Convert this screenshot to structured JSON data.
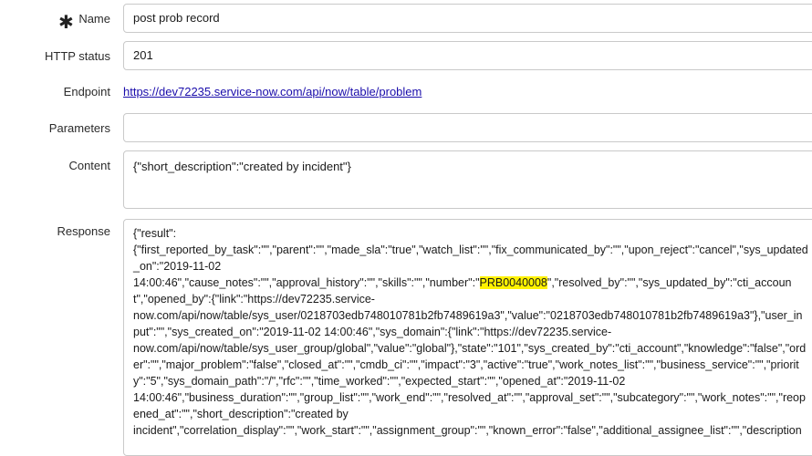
{
  "form": {
    "name": {
      "required_icon": "asterisk-icon",
      "required_glyph": "✱",
      "label": "Name",
      "value": "post prob record"
    },
    "http_status": {
      "label": "HTTP status",
      "value": "201"
    },
    "endpoint": {
      "label": "Endpoint",
      "value": "https://dev72235.service-now.com/api/now/table/problem"
    },
    "parameters": {
      "label": "Parameters",
      "value": ""
    },
    "content": {
      "label": "Content",
      "value": "{\"short_description\":\"created by incident\"}"
    },
    "response": {
      "label": "Response",
      "text_before": "{\"result\":\n{\"first_reported_by_task\":\"\",\"parent\":\"\",\"made_sla\":\"true\",\"watch_list\":\"\",\"fix_communicated_by\":\"\",\"upon_reject\":\"cancel\",\"sys_updated_on\":\"2019-11-02\n14:00:46\",\"cause_notes\":\"\",\"approval_history\":\"\",\"skills\":\"\",\"number\":\"",
      "highlight": "PRB0040008",
      "text_after": "\",\"resolved_by\":\"\",\"sys_updated_by\":\"cti_account\",\"opened_by\":{\"link\":\"https://dev72235.service-\nnow.com/api/now/table/sys_user/0218703edb748010781b2fb7489619a3\",\"value\":\"0218703edb748010781b2fb7489619a3\"},\"user_input\":\"\",\"sys_created_on\":\"2019-11-02 14:00:46\",\"sys_domain\":{\"link\":\"https://dev72235.service-\nnow.com/api/now/table/sys_user_group/global\",\"value\":\"global\"},\"state\":\"101\",\"sys_created_by\":\"cti_account\",\"knowledge\":\"false\",\"order\":\"\",\"major_problem\":\"false\",\"closed_at\":\"\",\"cmdb_ci\":\"\",\"impact\":\"3\",\"active\":\"true\",\"work_notes_list\":\"\",\"business_service\":\"\",\"priority\":\"5\",\"sys_domain_path\":\"/\",\"rfc\":\"\",\"time_worked\":\"\",\"expected_start\":\"\",\"opened_at\":\"2019-11-02\n14:00:46\",\"business_duration\":\"\",\"group_list\":\"\",\"work_end\":\"\",\"resolved_at\":\"\",\"approval_set\":\"\",\"subcategory\":\"\",\"work_notes\":\"\",\"reopened_at\":\"\",\"short_description\":\"created by\nincident\",\"correlation_display\":\"\",\"work_start\":\"\",\"assignment_group\":\"\",\"known_error\":\"false\",\"additional_assignee_list\":\"\",\"description"
    }
  },
  "colors": {
    "link": "#1a0dab",
    "highlight": "#fff200",
    "border": "#c9c9c9"
  }
}
